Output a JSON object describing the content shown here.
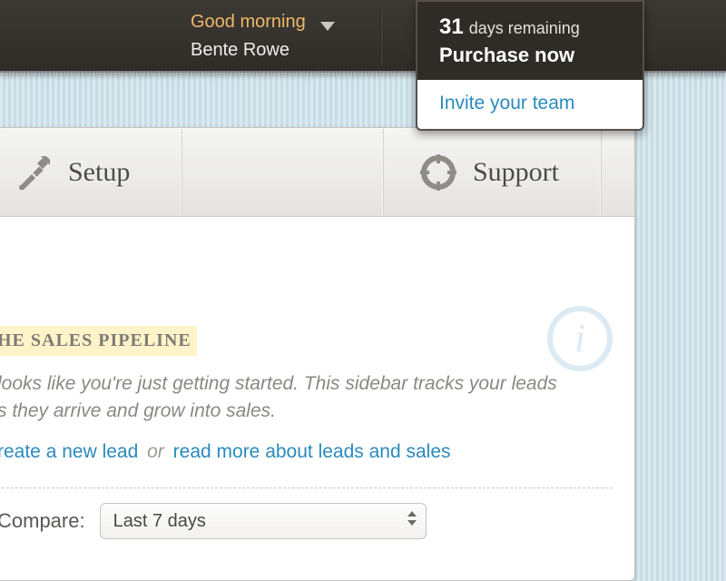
{
  "header": {
    "greeting": "Good morning",
    "user_name": "Bente Rowe",
    "trial_days": "31",
    "trial_remaining_label": "days remaining",
    "purchase_label": "Purchase now",
    "invite_label": "Invite your team"
  },
  "tabs": {
    "setup": "Setup",
    "support": "Support"
  },
  "pipeline": {
    "heading": "HE SALES PIPELINE",
    "intro_line1": " looks like you're just getting started. This sidebar tracks your leads",
    "intro_line2": "s they arrive and grow into sales.",
    "create_lead_link": "reate a new lead",
    "or": "or",
    "read_more_link": "read more about leads and sales"
  },
  "compare": {
    "label": "Compare:",
    "selected": "Last 7 days"
  }
}
